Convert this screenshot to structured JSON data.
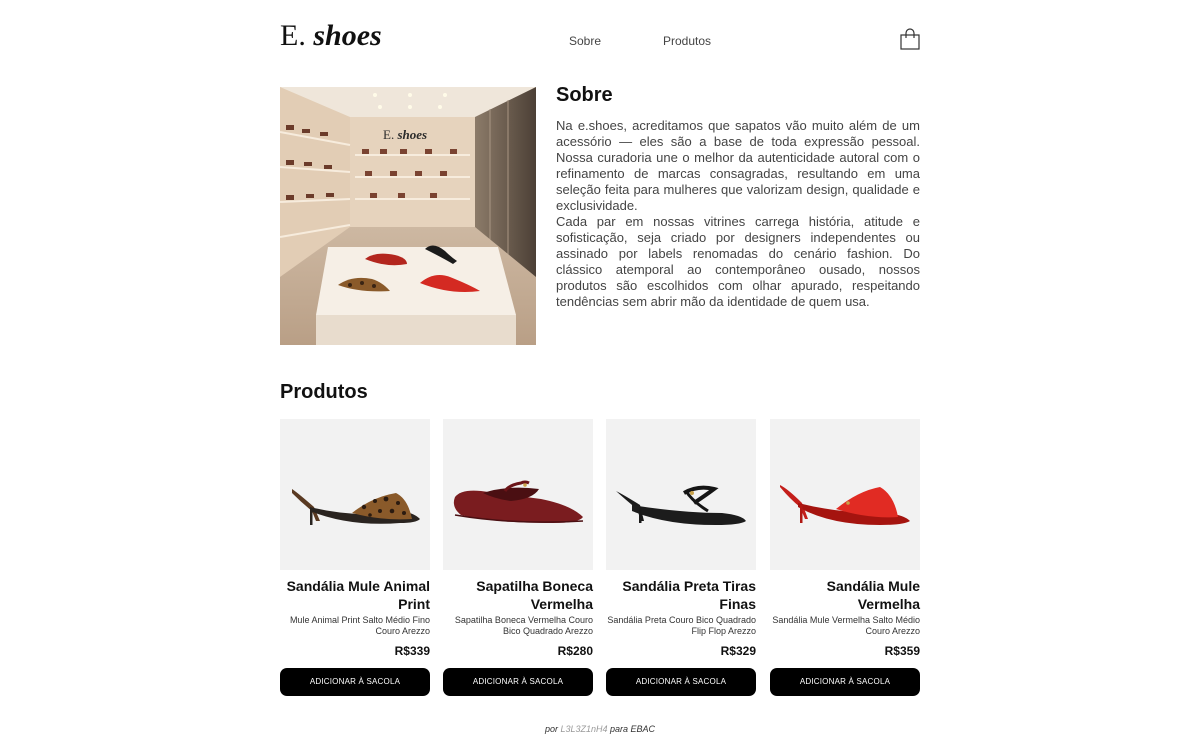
{
  "header": {
    "logo_prefix": "E.",
    "logo_name": "shoes",
    "nav": [
      {
        "label": "Sobre"
      },
      {
        "label": "Produtos"
      }
    ],
    "cart_icon": "shopping-bag-icon"
  },
  "about": {
    "image_logo_prefix": "E.",
    "image_logo_name": "shoes",
    "title": "Sobre",
    "paragraph_1": "Na e.shoes, acreditamos que sapatos vão muito além de um acessório — eles são a base de toda expressão pessoal. Nossa curadoria une o melhor da autenticidade autoral com o refinamento de marcas consagradas, resultando em uma seleção feita para mulheres que valorizam design, qualidade e exclusividade.",
    "paragraph_2": "Cada par em nossas vitrines carrega história, atitude e sofisticação, seja criado por designers independentes ou assinado por labels renomadas do cenário fashion. Do clássico atemporal ao contemporâneo ousado, nossos produtos são escolhidos com olhar apurado, respeitando tendências sem abrir mão da identidade de quem usa."
  },
  "products": {
    "title": "Produtos",
    "items": [
      {
        "name": "Sandália Mule Animal Print",
        "description": "Mule Animal Print Salto Médio Fino Couro Arezzo",
        "price": "R$339",
        "button": "ADICIONAR À SACOLA"
      },
      {
        "name": "Sapatilha Boneca Vermelha",
        "description": "Sapatilha Boneca Vermelha Couro Bico Quadrado Arezzo",
        "price": "R$280",
        "button": "ADICIONAR À SACOLA"
      },
      {
        "name": "Sandália Preta Tiras Finas",
        "description": "Sandália Preta Couro Bico Quadrado Flip Flop Arezzo",
        "price": "R$329",
        "button": "ADICIONAR À SACOLA"
      },
      {
        "name": "Sandália Mule Vermelha",
        "description": "Sandália Mule Vermelha Salto Médio Couro Arezzo",
        "price": "R$359",
        "button": "ADICIONAR À SACOLA"
      }
    ]
  },
  "footer": {
    "prefix": "por",
    "author": "L3L3Z1nH4",
    "suffix": "para EBAC"
  },
  "colors": {
    "text": "#111111",
    "body_text": "#444444",
    "button_bg": "#000000",
    "card_bg": "#f2f2f2",
    "footer_author": "#9a9a9a"
  }
}
